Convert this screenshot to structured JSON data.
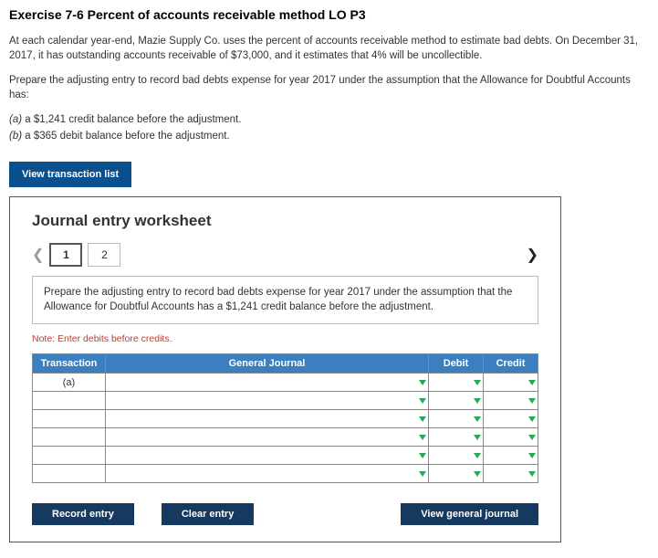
{
  "title": "Exercise 7-6 Percent of accounts receivable method LO P3",
  "para1": "At each calendar year-end, Mazie Supply Co. uses the percent of accounts receivable method to estimate bad debts. On December 31, 2017, it has outstanding accounts receivable of $73,000, and it estimates that 4% will be uncollectible.",
  "para2": "Prepare the adjusting entry to record bad debts expense for year 2017 under the assumption that the Allowance for Doubtful Accounts has:",
  "opt_a_prefix": "(a) ",
  "opt_a": "a $1,241 credit balance before the adjustment.",
  "opt_b_prefix": "(b) ",
  "opt_b": "a $365 debit balance before the adjustment.",
  "view_list_btn": "View transaction list",
  "worksheet": {
    "heading": "Journal entry worksheet",
    "tabs": [
      "1",
      "2"
    ],
    "instruction": "Prepare the adjusting entry to record bad debts expense for year 2017 under the assumption that the Allowance for Doubtful Accounts has a $1,241 credit balance before the adjustment.",
    "note": "Note: Enter debits before credits.",
    "cols": {
      "transaction": "Transaction",
      "gj": "General Journal",
      "debit": "Debit",
      "credit": "Credit"
    },
    "row1_trans": "(a)",
    "btn_record": "Record entry",
    "btn_clear": "Clear entry",
    "btn_view": "View general journal"
  }
}
